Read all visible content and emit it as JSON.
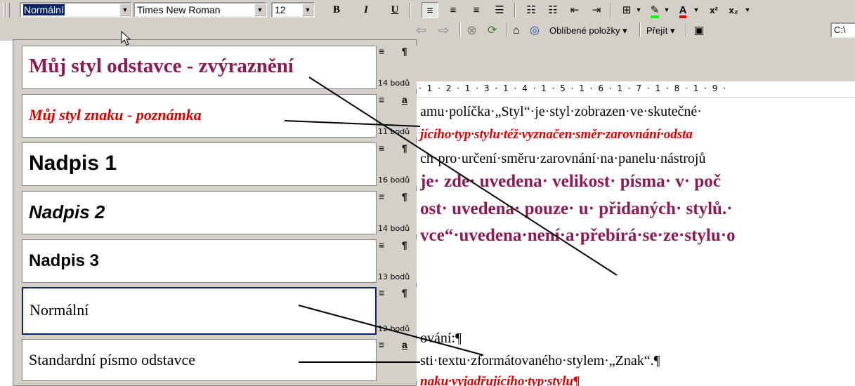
{
  "formatting_toolbar": {
    "style_value": "Normální",
    "font_value": "Times New Roman",
    "size_value": "12",
    "bold_label": "B",
    "italic_label": "I",
    "underline_label": "U",
    "superscript_label": "x²",
    "subscript_label": "x₂"
  },
  "web_toolbar": {
    "favorites_label": "Oblíbené položky ▾",
    "goto_label": "Přejít ▾",
    "address_value": "C:\\"
  },
  "ruler": {
    "marks": "· 1 · 2 · 1 · 3 · 1 · 4 · 1 · 5 · 1 · 6 · 1 · 7 · 1 · 8 · 1 · 9 ·"
  },
  "document": {
    "lines": [
      "amu·políčka·„Styl“·je·styl·zobrazen·ve·skutečné·",
      "jícího·typ·stylu·též·vyznačen·směr·zarovnání·odsta",
      "ch·pro·určení·směru·zarovnání·na·panelu·nástrojů",
      "je· zde· uvedena· velikost· písma· v· poč",
      "ost· uvedena· pouze· u· přidaných· stylů.·",
      "vce“·uvedena·není·a·přebírá·se·ze·stylu·o",
      "ování:¶",
      "sti·textu·zformátovaného·stylem·„Znak“.¶",
      "naku·vyjadřujícího·typ·stylu¶"
    ]
  },
  "style_list": [
    {
      "name": "Můj styl odstavce - zvýraznění",
      "align": "≡",
      "type": "¶",
      "size": "14 bodů"
    },
    {
      "name": "Můj styl znaku - poznámka",
      "align": "≡",
      "type": "a",
      "size": "11 bodů"
    },
    {
      "name": "Nadpis 1",
      "align": "≡",
      "type": "¶",
      "size": "16 bodů"
    },
    {
      "name": "Nadpis 2",
      "align": "≡",
      "type": "¶",
      "size": "14 bodů"
    },
    {
      "name": "Nadpis 3",
      "align": "≡",
      "type": "¶",
      "size": "13 bodů"
    },
    {
      "name": "Normální",
      "align": "≡",
      "type": "¶",
      "size": "12 bodů"
    },
    {
      "name": "Standardní písmo odstavce",
      "align": "≡",
      "type": "a",
      "size": ""
    }
  ],
  "colors": {
    "toolbar_bg": "#d4d0c8",
    "selection": "#0a246a",
    "emphasis_purple": "#8b1a55",
    "note_red": "#e00000"
  }
}
